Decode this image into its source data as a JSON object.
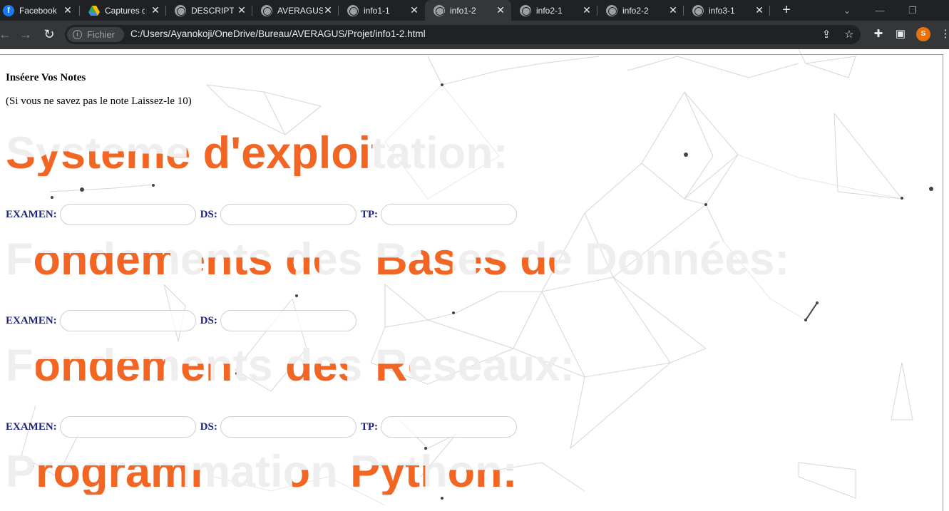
{
  "browser": {
    "tabs": [
      {
        "title": "Facebook",
        "icon": "facebook-icon"
      },
      {
        "title": "Captures d",
        "icon": "google-drive-icon"
      },
      {
        "title": "DESCRIPTI",
        "icon": "globe-icon"
      },
      {
        "title": "AVERAGUS",
        "icon": "globe-icon"
      },
      {
        "title": "info1-1",
        "icon": "globe-icon"
      },
      {
        "title": "info1-2",
        "icon": "globe-icon",
        "active": true
      },
      {
        "title": "info2-1",
        "icon": "globe-icon"
      },
      {
        "title": "info2-2",
        "icon": "globe-icon"
      },
      {
        "title": "info3-1",
        "icon": "globe-icon"
      }
    ],
    "site_chip": "Fichier",
    "url": "C:/Users/Ayanokoji/OneDrive/Bureau/AVERAGUS/Projet/info1-2.html",
    "profile_initial": "S"
  },
  "page": {
    "heading": "Inséere Vos Notes",
    "hint": "(Si vous ne savez pas le note Laissez-le 10)",
    "subjects": [
      {
        "title": "Systeme d'exploitation:",
        "fields": [
          {
            "label": "EXAMEN:",
            "value": ""
          },
          {
            "label": "DS:",
            "value": ""
          },
          {
            "label": "TP:",
            "value": ""
          }
        ]
      },
      {
        "title": "Fondements des Bases de Données:",
        "fields": [
          {
            "label": "EXAMEN:",
            "value": ""
          },
          {
            "label": "DS:",
            "value": ""
          }
        ]
      },
      {
        "title": "Fondements des Reseaux:",
        "fields": [
          {
            "label": "EXAMEN:",
            "value": ""
          },
          {
            "label": "DS:",
            "value": ""
          },
          {
            "label": "TP:",
            "value": ""
          }
        ]
      },
      {
        "title": "Programmation Python:",
        "fields": []
      }
    ]
  },
  "colors": {
    "accent_orange": "#f26522",
    "label_navy": "#1a237e",
    "ghost_text": "#eeeeee"
  }
}
